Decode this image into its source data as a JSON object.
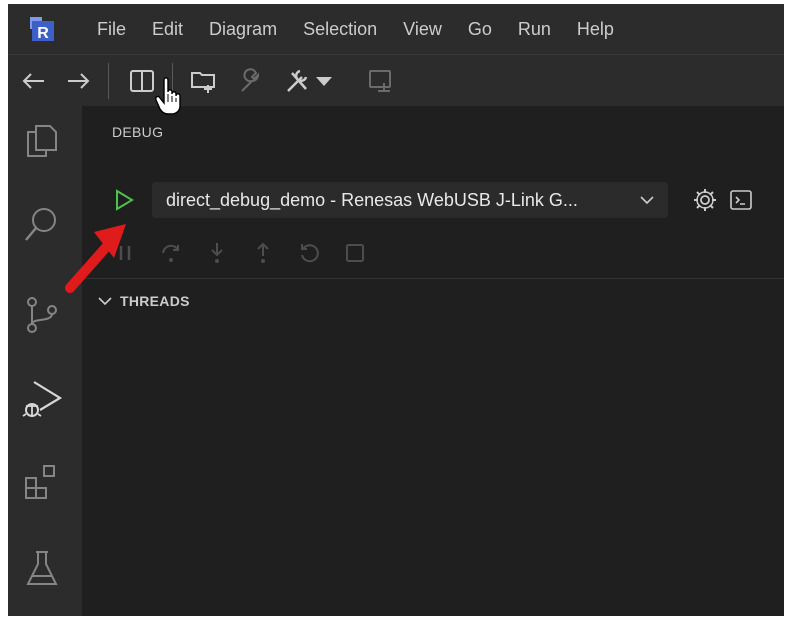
{
  "app": {
    "logo_letter": "R",
    "accent_color": "#4a6fd8"
  },
  "menubar": {
    "items": [
      "File",
      "Edit",
      "Diagram",
      "Selection",
      "View",
      "Go",
      "Run",
      "Help"
    ]
  },
  "toolbar": {
    "icons": [
      "arrow-left-icon",
      "arrow-right-icon",
      "split-editor-icon",
      "new-folder-icon",
      "wrench-icon",
      "tools-dropdown-icon",
      "flash-device-icon"
    ]
  },
  "activitybar": {
    "icons": [
      "explorer-icon",
      "search-icon",
      "source-control-icon",
      "run-debug-icon",
      "extensions-icon",
      "testing-icon"
    ],
    "active": "run-debug-icon"
  },
  "debug_panel": {
    "title": "DEBUG",
    "launch_config": "direct_debug_demo - Renesas WebUSB J-Link G...",
    "play_color": "#4ec14e",
    "debug_controls": [
      "pause-icon",
      "step-over-icon",
      "step-into-icon",
      "step-out-icon",
      "restart-icon",
      "stop-icon"
    ],
    "sections": [
      {
        "label": "THREADS",
        "expanded": true
      }
    ]
  },
  "annotation": {
    "arrow_color": "#e01b1b"
  }
}
